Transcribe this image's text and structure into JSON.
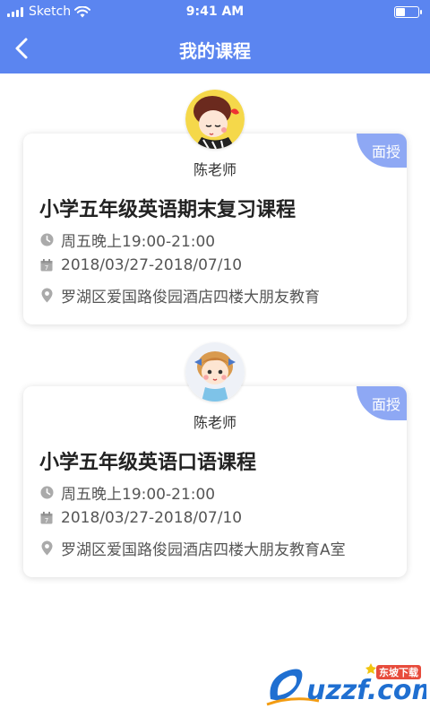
{
  "status_bar": {
    "carrier": "Sketch",
    "time": "9:41 AM",
    "battery_level": 0.45
  },
  "header": {
    "title": "我的课程",
    "back_icon": "chevron-left-icon"
  },
  "courses": [
    {
      "teacher": "陈老师",
      "badge": "面授",
      "title": "小学五年级英语期末复习课程",
      "schedule": "周五晚上19:00-21:00",
      "date_range": "2018/03/27-2018/07/10",
      "location": "罗湖区爱国路俊园酒店四楼大朋友教育"
    },
    {
      "teacher": "陈老师",
      "badge": "面授",
      "title": "小学五年级英语口语课程",
      "schedule": "周五晚上19:00-21:00",
      "date_range": "2018/03/27-2018/07/10",
      "location": "罗湖区爱国路俊园酒店四楼大朋友教育A室"
    }
  ],
  "watermark": {
    "text": "uzzf.com",
    "tag": "东坡下载"
  },
  "colors": {
    "header_bg": "#5b85f0",
    "badge_bg": "#8ea8f4"
  }
}
